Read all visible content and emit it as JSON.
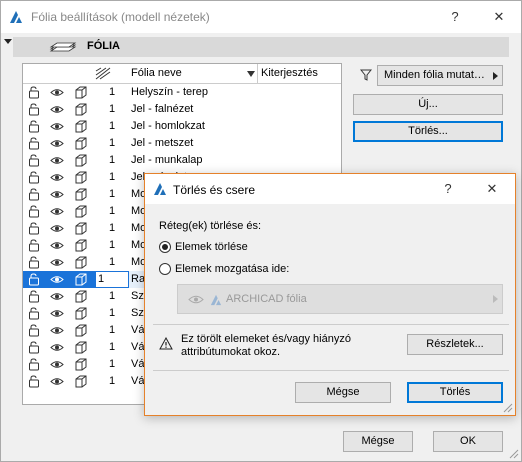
{
  "main_window": {
    "title": "Fólia beállítások (modell nézetek)",
    "help_label": "?",
    "close_label": "✕"
  },
  "section": {
    "title": "FÓLIA"
  },
  "table": {
    "header_name": "Fólia neve",
    "header_extension": "Kiterjesztés",
    "rows": [
      {
        "num": "1",
        "name": "Helyszín - terep"
      },
      {
        "num": "1",
        "name": "Jel - falnézet"
      },
      {
        "num": "1",
        "name": "Jel - homlokzat"
      },
      {
        "num": "1",
        "name": "Jel - metszet"
      },
      {
        "num": "1",
        "name": "Jel - munkalap"
      },
      {
        "num": "1",
        "name": "Jel - részlet"
      },
      {
        "num": "1",
        "name": "Mo"
      },
      {
        "num": "1",
        "name": "Mo"
      },
      {
        "num": "1",
        "name": "Mo"
      },
      {
        "num": "1",
        "name": "Mo"
      },
      {
        "num": "1",
        "name": "Mo"
      },
      {
        "num": "1",
        "name": "Ra"
      },
      {
        "num": "1",
        "name": "Sz"
      },
      {
        "num": "1",
        "name": "Sz"
      },
      {
        "num": "1",
        "name": "Vá"
      },
      {
        "num": "1",
        "name": "Vá"
      },
      {
        "num": "1",
        "name": "Vá"
      },
      {
        "num": "1",
        "name": "Vá"
      }
    ]
  },
  "right_panel": {
    "filter_label": "Minden fólia mutat…",
    "new_label": "Új...",
    "delete_label": "Törlés..."
  },
  "bottom": {
    "cancel_label": "Mégse",
    "ok_label": "OK"
  },
  "dialog": {
    "title": "Törlés és csere",
    "help_label": "?",
    "close_label": "✕",
    "prompt": "Réteg(ek) törlése és:",
    "option_delete": "Elemek törlése",
    "option_move": "Elemek mozgatása ide:",
    "combo_value": "ARCHICAD fólia",
    "warning_text_1": "Ez törölt elemeket és/vagy hiányzó",
    "warning_text_2": "attribútumokat okoz.",
    "details_label": "Részletek...",
    "cancel_label": "Mégse",
    "delete_label": "Törlés"
  },
  "colors": {
    "selection": "#1a73d9",
    "dialog_border": "#e5812a",
    "focus": "#0078d7"
  }
}
